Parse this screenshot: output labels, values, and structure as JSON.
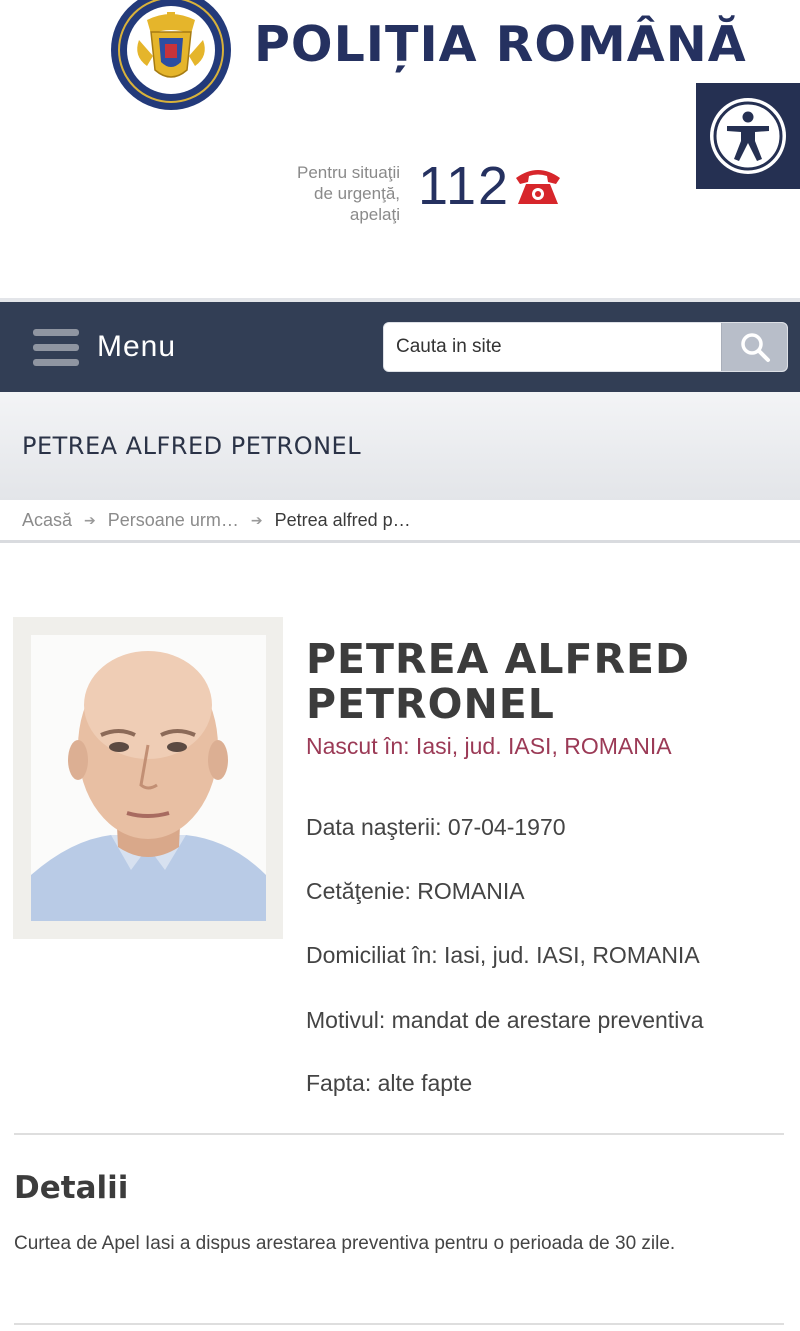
{
  "header": {
    "brand_title": "POLIȚIA ROMÂNĂ",
    "emergency_text_lines": [
      "Pentru situaţii",
      "de urgenţă,",
      "apelaţi"
    ],
    "emergency_number": "112",
    "accessibility_icon": "accessibility-icon"
  },
  "nav": {
    "menu_label": "Menu",
    "search_placeholder": "Cauta in site",
    "search_icon": "search-icon"
  },
  "page_title": "PETREA ALFRED PETRONEL",
  "breadcrumb": {
    "home": "Acasă",
    "section": "Persoane urm…",
    "current": "Petrea alfred p…"
  },
  "person": {
    "name_line1": "PETREA ALFRED",
    "name_line2": "PETRONEL",
    "born": "Nascut în: Iasi, jud. IASI, ROMANIA",
    "birth_date": "Data naşterii: 07-04-1970",
    "citizenship": "Cetăţenie: ROMANIA",
    "residence": "Domiciliat în: Iasi, jud. IASI, ROMANIA",
    "reason": "Motivul: mandat de arestare preventiva",
    "offense": "Fapta: alte fapte"
  },
  "details": {
    "heading": "Detalii",
    "text": "Curtea de Apel Iasi a dispus arestarea preventiva pentru o perioada de 30 zile."
  },
  "colors": {
    "brand_navy": "#253160",
    "navbar": "#323e55",
    "accent_red": "#d7262b",
    "born_text": "#9b3a56"
  }
}
